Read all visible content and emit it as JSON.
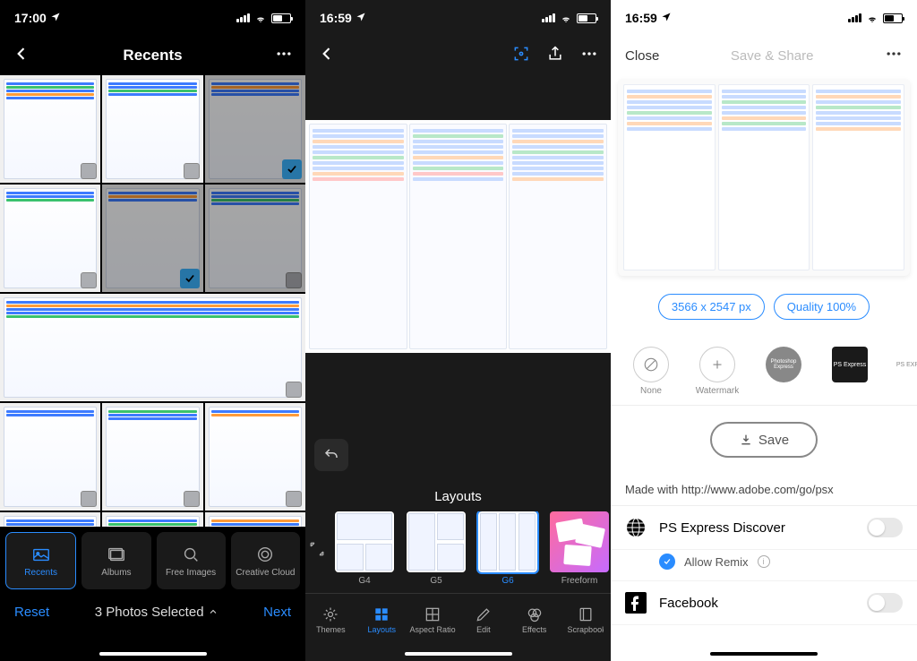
{
  "pane1": {
    "status_time": "17:00",
    "title": "Recents",
    "tabs": [
      {
        "label": "Recents",
        "active": true
      },
      {
        "label": "Albums",
        "active": false
      },
      {
        "label": "Free Images",
        "active": false
      },
      {
        "label": "Creative Cloud",
        "active": false
      }
    ],
    "reset": "Reset",
    "selected": "3 Photos Selected",
    "next": "Next"
  },
  "pane2": {
    "status_time": "16:59",
    "layouts_title": "Layouts",
    "layout_items": [
      {
        "label": "G4",
        "sel": false
      },
      {
        "label": "G5",
        "sel": false
      },
      {
        "label": "G6",
        "sel": true
      },
      {
        "label": "Freeform",
        "sel": false
      }
    ],
    "bottom_tabs": [
      {
        "label": "Themes",
        "active": false
      },
      {
        "label": "Layouts",
        "active": true
      },
      {
        "label": "Aspect Ratio",
        "active": false
      },
      {
        "label": "Edit",
        "active": false
      },
      {
        "label": "Effects",
        "active": false
      },
      {
        "label": "Scrapbook",
        "active": false
      }
    ]
  },
  "pane3": {
    "status_time": "16:59",
    "close": "Close",
    "save_share": "Save & Share",
    "dims": "3566 x 2547 px",
    "quality": "Quality 100%",
    "wm": {
      "none": "None",
      "watermark": "Watermark",
      "ps1": "PS Express",
      "ps2": "PS EXPRESS"
    },
    "save": "Save",
    "made_with": "Made with http://www.adobe.com/go/psx",
    "discover": "PS Express Discover",
    "allow_remix": "Allow Remix",
    "facebook": "Facebook"
  }
}
